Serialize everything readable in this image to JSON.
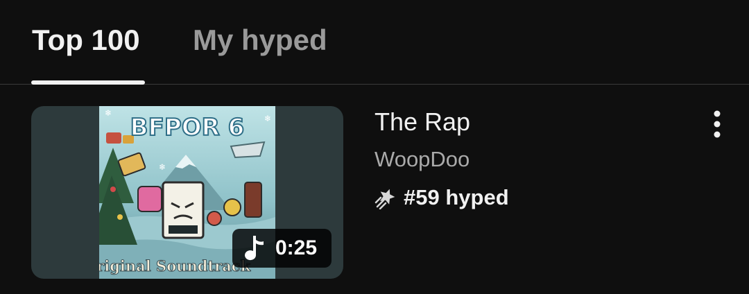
{
  "tabs": [
    {
      "label": "Top 100",
      "active": true
    },
    {
      "label": "My hyped",
      "active": false
    }
  ],
  "video": {
    "title": "The Rap",
    "channel": "WoopDoo",
    "hype": "#59 hyped",
    "duration": "0:25",
    "thumbnail": {
      "album_title": "BFPOR 6",
      "album_subtitle": "Original Soundtrack"
    }
  },
  "icons": {
    "hype": "hype-rocket-icon",
    "duration": "music-note-icon",
    "more": "more-vertical-icon"
  },
  "colors": {
    "background": "#0f0f0f",
    "text_primary": "#f1f1f1",
    "text_secondary": "#aaaaaa",
    "tab_inactive": "#9a9a9a"
  }
}
